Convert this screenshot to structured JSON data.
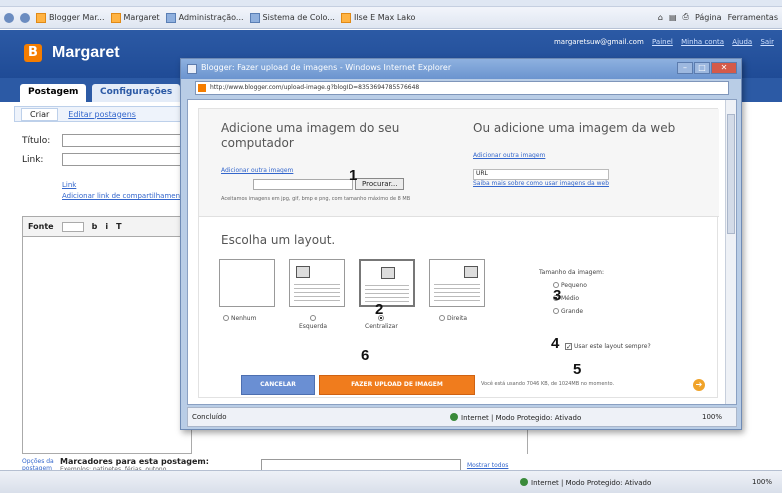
{
  "window": {
    "title": "Blogger: Margaret"
  },
  "bookmarks": [
    "Blogger Mar...",
    "Margaret",
    "Administração...",
    "Sistema de Colo...",
    "Ilse E Max Lako"
  ],
  "toolbar_right": [
    "Página",
    "Ferramentas"
  ],
  "blogger": {
    "title": "Margaret",
    "user_email": "margaretsuw@gmail.com",
    "user_links": [
      "Painel",
      "Minha conta",
      "Ajuda",
      "Sair"
    ],
    "tabs": [
      "Postagem",
      "Configurações"
    ],
    "subtabs": [
      "Criar",
      "Editar postagens"
    ],
    "form": {
      "title_label": "Título:",
      "link_label": "Link:"
    },
    "small_links": [
      "Link",
      "Adicionar link de compartilhamento"
    ],
    "editor": {
      "font": "Fonte"
    },
    "labels_section": {
      "icon_text": "Opções da postagem",
      "title": "Marcadores para esta postagem:",
      "subtitle": "Exemplos: patinetes, férias, outono",
      "link": "Mostrar todos"
    }
  },
  "popup": {
    "title": "Blogger: Fazer upload de imagens - Windows Internet Explorer",
    "address": "http://www.blogger.com/upload-image.g?blogID=8353694785576648",
    "upload_from_computer": {
      "heading": "Adicione uma imagem do seu computador",
      "add_more": "Adicionar outra imagem",
      "browse": "Procurar...",
      "note": "Aceitamos imagens em jpg, gif, bmp e png, com tamanho máximo de 8 MB"
    },
    "upload_from_web": {
      "heading": "Ou adicione uma imagem da web",
      "add_more": "Adicionar outra imagem",
      "url_value": "URL",
      "help": "Saiba mais sobre como usar imagens da web"
    },
    "layout": {
      "heading": "Escolha um layout.",
      "options": [
        {
          "label": "Nenhum",
          "selected": false
        },
        {
          "label": "Esquerda",
          "selected": false
        },
        {
          "label": "Centralizar",
          "selected": true
        },
        {
          "label": "Direita",
          "selected": false
        }
      ]
    },
    "image_size": {
      "title": "Tamanho da imagem:",
      "options": [
        {
          "label": "Pequeno",
          "selected": false
        },
        {
          "label": "Médio",
          "selected": true
        },
        {
          "label": "Grande",
          "selected": false
        }
      ]
    },
    "always_use_layout": {
      "label": "Usar este layout sempre?",
      "checked": true
    },
    "buttons": {
      "cancel": "CANCELAR",
      "upload": "FAZER UPLOAD DE IMAGEM"
    },
    "terms": "Você está usando 7046 KB, de 1024MB no momento.",
    "status": {
      "left": "Concluído",
      "mid": "Internet | Modo Protegido: Ativado",
      "zoom": "100%"
    }
  },
  "annotations": [
    "1",
    "2",
    "3",
    "4",
    "5",
    "6"
  ],
  "statusbar": {
    "zone": "Internet | Modo Protegido: Ativado",
    "zoom": "100%"
  }
}
